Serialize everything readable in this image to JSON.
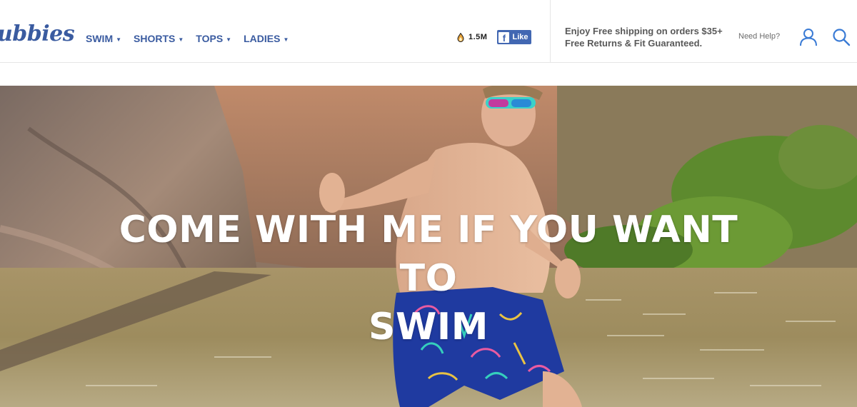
{
  "brand": {
    "logo_text": "ubbies",
    "color": "#3a5ba0"
  },
  "nav": {
    "items": [
      {
        "label": "SWIM",
        "icon": "chevron-down-icon"
      },
      {
        "label": "SHORTS",
        "icon": "chevron-down-icon"
      },
      {
        "label": "TOPS",
        "icon": "chevron-down-icon"
      },
      {
        "label": "LADIES",
        "icon": "chevron-down-icon"
      }
    ]
  },
  "social": {
    "count_icon": "flame-icon",
    "count": "1.5M",
    "fb_icon": "facebook-f-icon",
    "fb_like": "Like",
    "fb_color": "#4267b2"
  },
  "promo": {
    "line1": "Enjoy Free shipping on orders $35+",
    "line2": "Free Returns & Fit Guaranteed."
  },
  "utility": {
    "help": "Need Help?",
    "account_icon": "user-icon",
    "search_icon": "search-icon"
  },
  "hero": {
    "title_line1": "COME WITH ME IF YOU WANT TO",
    "title_line2": "SWIM"
  }
}
